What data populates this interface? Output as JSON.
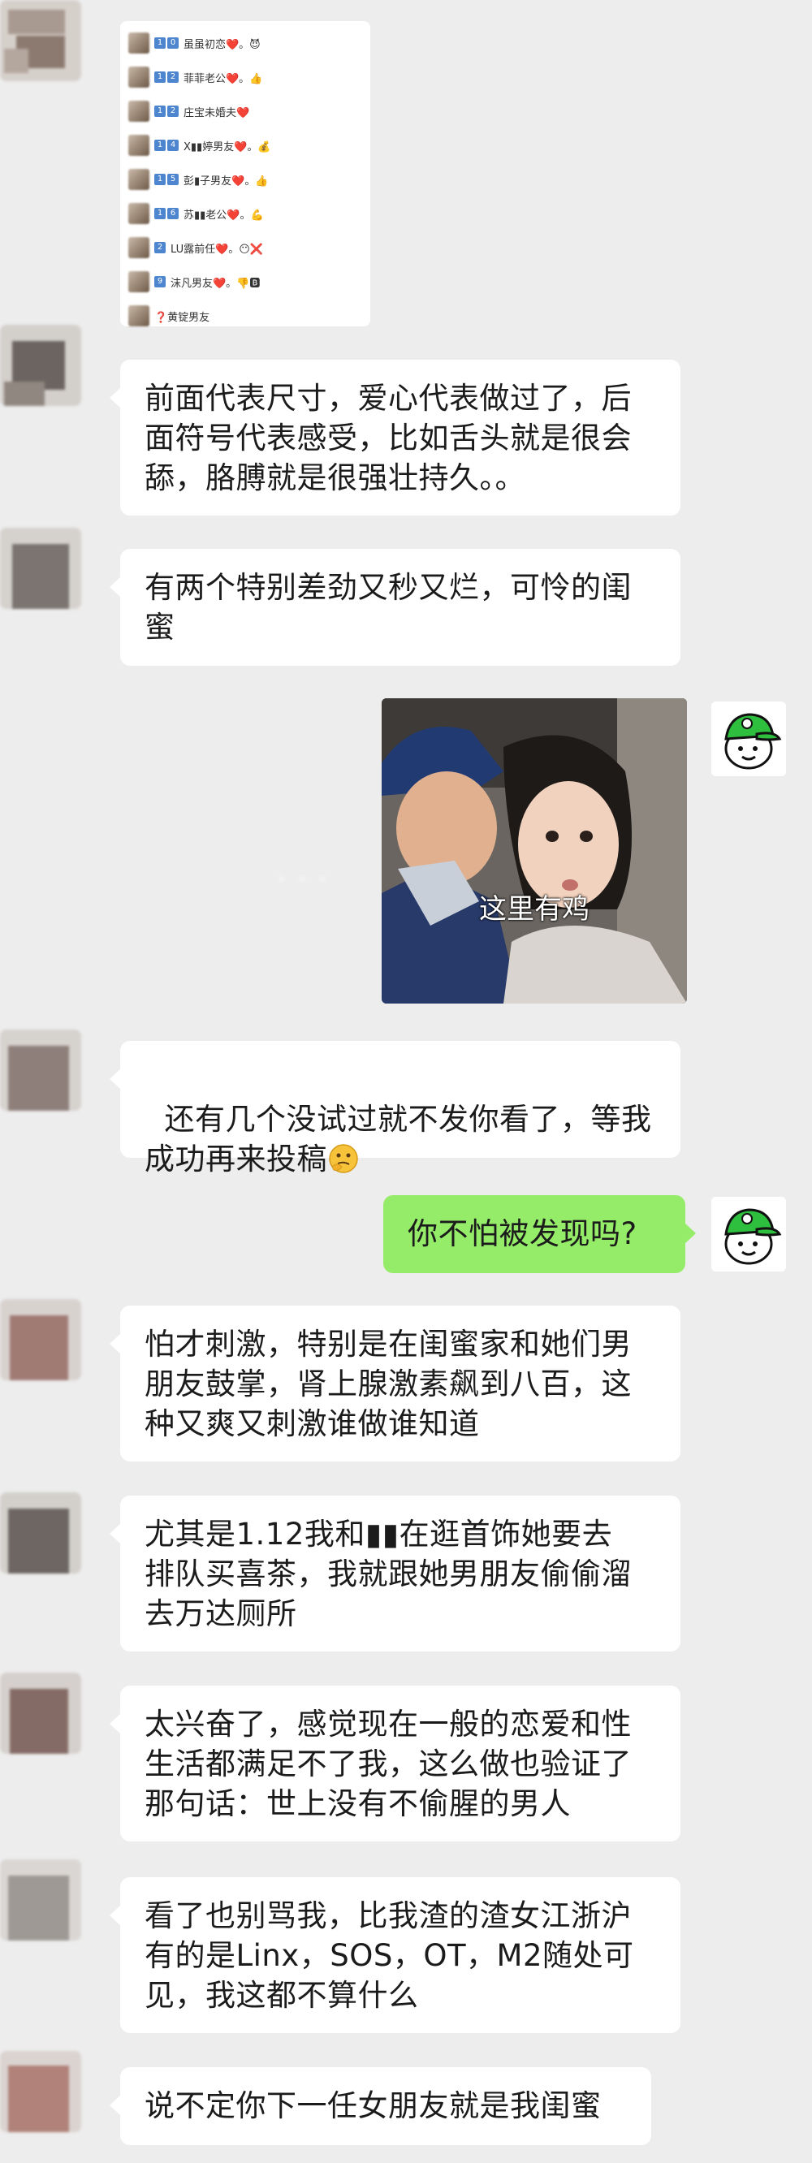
{
  "list_screenshot": {
    "rows": [
      {
        "nums": [
          "1",
          "0"
        ],
        "label": "虽虽初恋❤️。😈"
      },
      {
        "nums": [
          "1",
          "2"
        ],
        "label": "菲菲老公❤️。👍"
      },
      {
        "nums": [
          "1",
          "2"
        ],
        "label": "庄宝未婚夫❤️"
      },
      {
        "nums": [
          "1",
          "4"
        ],
        "label": "X▮▮婷男友❤️。💰"
      },
      {
        "nums": [
          "1",
          "5"
        ],
        "label": "彭▮子男友❤️。👍"
      },
      {
        "nums": [
          "1",
          "6"
        ],
        "label": "苏▮▮老公❤️。💪"
      },
      {
        "nums": [
          "2"
        ],
        "label": "LU露前任❤️。😶❌"
      },
      {
        "nums": [
          "9"
        ],
        "label": "沫凡男友❤️。👎🅱"
      },
      {
        "nums": [],
        "label": "❓黄锭男友"
      }
    ]
  },
  "messages": [
    {
      "id": "m1",
      "text": "前面代表尺寸，爱心代表做过了，后\n面符号代表感受，比如舌头就是很会\n舔，胳膊就是很强壮持久。。"
    },
    {
      "id": "m2",
      "text": "有两个特别差劲又秒又烂，可怜的闺\n蜜"
    },
    {
      "id": "m3",
      "text": "还有几个没试过就不发你看了，等我\n成功再来投稿"
    },
    {
      "id": "m4",
      "text": "你不怕被发现吗?"
    },
    {
      "id": "m5",
      "text": "怕才刺激，特别是在闺蜜家和她们男\n朋友鼓掌，肾上腺激素飙到八百，这\n种又爽又刺激谁做谁知道"
    },
    {
      "id": "m6",
      "text": "尤其是1.12我和▮▮在逛首饰她要去\n排队买喜茶，我就跟她男朋友偷偷溜\n去万达厕所"
    },
    {
      "id": "m7",
      "text": "太兴奋了，感觉现在一般的恋爱和性\n生活都满足不了我，这么做也验证了\n那句话：世上没有不偷腥的男人"
    },
    {
      "id": "m8",
      "text": "看了也别骂我，比我渣的渣女江浙沪\n有的是Linx，SOS，OT，M2随处可\n见，我这都不算什么"
    },
    {
      "id": "m9",
      "text": "说不定你下一任女朋友就是我闺蜜"
    }
  ],
  "meme": {
    "caption": "这里有鸡"
  },
  "icons": {
    "left_avatar": "blurred-avatar",
    "right_avatar": "green-cap-face-icon",
    "thinking_emoji": "thinking-face-icon"
  },
  "colors": {
    "background": "#ededed",
    "sent_bubble": "#95ec69",
    "received_bubble": "#ffffff"
  }
}
